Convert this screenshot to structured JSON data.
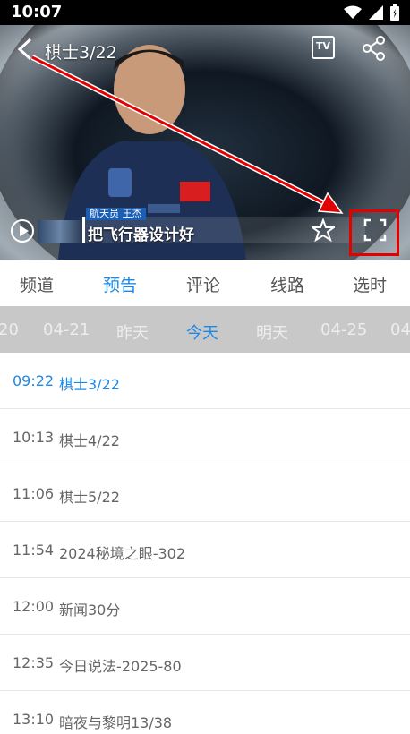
{
  "status_bar": {
    "time": "10:07"
  },
  "player": {
    "title": "棋士3/22",
    "tv_label": "TV",
    "caption_tag": "航天员  王杰",
    "caption": "把飞行器设计好"
  },
  "tabs": [
    {
      "label": "频道",
      "active": false
    },
    {
      "label": "预告",
      "active": true
    },
    {
      "label": "评论",
      "active": false
    },
    {
      "label": "线路",
      "active": false
    },
    {
      "label": "选时",
      "active": false
    }
  ],
  "dates": [
    {
      "label": "20"
    },
    {
      "label": "04-21"
    },
    {
      "label": "昨天"
    },
    {
      "label": "今天",
      "active": true
    },
    {
      "label": "明天"
    },
    {
      "label": "04-25"
    },
    {
      "label": "04"
    }
  ],
  "schedule": [
    {
      "time": "09:22",
      "title": "棋士3/22",
      "active": true
    },
    {
      "time": "10:13",
      "title": "棋士4/22"
    },
    {
      "time": "11:06",
      "title": "棋士5/22"
    },
    {
      "time": "11:54",
      "title": "2024秘境之眼-302"
    },
    {
      "time": "12:00",
      "title": "新闻30分"
    },
    {
      "time": "12:35",
      "title": "今日说法-2025-80"
    },
    {
      "time": "13:10",
      "title": "暗夜与黎明13/38"
    }
  ],
  "colors": {
    "accent": "#1e88e5",
    "annotation": "#e30000"
  }
}
